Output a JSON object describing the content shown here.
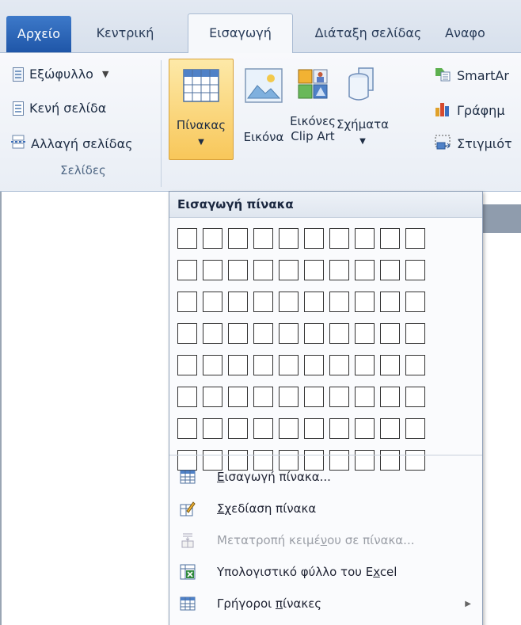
{
  "tabs": [
    {
      "label": "Αρχείο",
      "type": "file"
    },
    {
      "label": "Κεντρική",
      "type": "normal"
    },
    {
      "label": "Εισαγωγή",
      "type": "active"
    },
    {
      "label": "Διάταξη σελίδας",
      "type": "normal"
    },
    {
      "label": "Αναφο",
      "type": "normal"
    }
  ],
  "pages_group": {
    "label": "Σελίδες",
    "items": [
      {
        "label": "Εξώφυλλο",
        "icon": "cover-page-icon",
        "has_dropdown": true
      },
      {
        "label": "Κενή σελίδα",
        "icon": "blank-page-icon"
      },
      {
        "label": "Αλλαγή σελίδας",
        "icon": "page-break-icon"
      }
    ]
  },
  "ribbon_buttons": {
    "table": {
      "label": "Πίνακας",
      "icon": "table-icon",
      "pressed": true
    },
    "picture": {
      "label": "Εικόνα",
      "icon": "picture-icon"
    },
    "clipart": {
      "line1": "Εικόνες",
      "line2": "Clip Art",
      "icon": "clipart-icon"
    },
    "shapes": {
      "label": "Σχήματα",
      "icon": "shapes-icon",
      "has_dropdown": true
    },
    "smartart": {
      "label": "SmartAr",
      "icon": "smartart-icon"
    },
    "chart": {
      "label": "Γράφημ",
      "icon": "chart-icon"
    },
    "screenshot": {
      "label": "Στιγμιότ",
      "icon": "screenshot-icon"
    }
  },
  "table_menu": {
    "header": "Εισαγωγή πίνακα",
    "grid": {
      "columns": 10,
      "rows": 8
    },
    "items": [
      {
        "pre": "",
        "key": "Ε",
        "post": "ισαγωγή πίνακα...",
        "icon": "insert-table-icon",
        "enabled": true,
        "submenu": false
      },
      {
        "pre": "",
        "key": "Σ",
        "post": "χεδίαση πίνακα",
        "icon": "draw-table-icon",
        "enabled": true,
        "submenu": false
      },
      {
        "pre": "Μετατροπή κειμέ",
        "key": "ν",
        "post": "ου σε πίνακα...",
        "icon": "convert-text-icon",
        "enabled": false,
        "submenu": false
      },
      {
        "pre": "Υπολογιστικό φύλλο του E",
        "key": "x",
        "post": "cel",
        "icon": "excel-spreadsheet-icon",
        "enabled": true,
        "submenu": false
      },
      {
        "pre": "Γρήγοροι ",
        "key": "π",
        "post": "ίνακες",
        "icon": "quick-tables-icon",
        "enabled": true,
        "submenu": true
      }
    ]
  },
  "colors": {
    "file_tab": "#2b62b6",
    "pressed_button": "#f8c75a",
    "ribbon_border": "#a9bbd3"
  }
}
